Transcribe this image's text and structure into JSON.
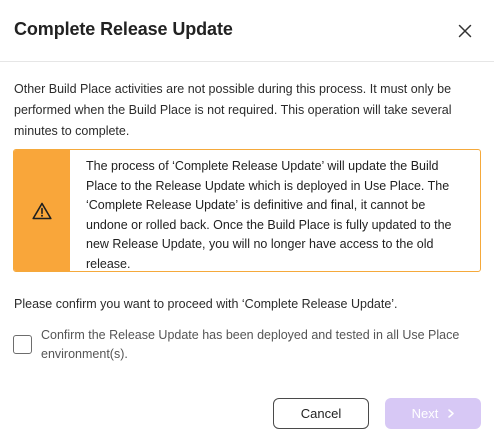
{
  "dialog": {
    "title": "Complete Release Update",
    "intro_text": "Other Build Place activities are not possible during this process. It must only be performed when the Build Place is not required. This operation will take several minutes to complete.",
    "warning": {
      "icon": "warning-triangle-icon",
      "color": "#f9a63a",
      "text": "The process of ‘Complete Release Update’ will update the Build Place to the Release Update which is deployed in Use Place. The ‘Complete Release Update’ is definitive and final, it cannot be undone or rolled back. Once the Build Place is fully updated to the new Release Update, you will no longer have access to the old release."
    },
    "confirm_question": "Please confirm you want to proceed with ‘Complete Release Update’.",
    "checkbox": {
      "label": "Confirm the Release Update has been deployed and tested in all Use Place environment(s).",
      "checked": false
    },
    "buttons": {
      "cancel_label": "Cancel",
      "next_label": "Next",
      "next_enabled": false,
      "next_color": "#d7c8f5"
    }
  }
}
